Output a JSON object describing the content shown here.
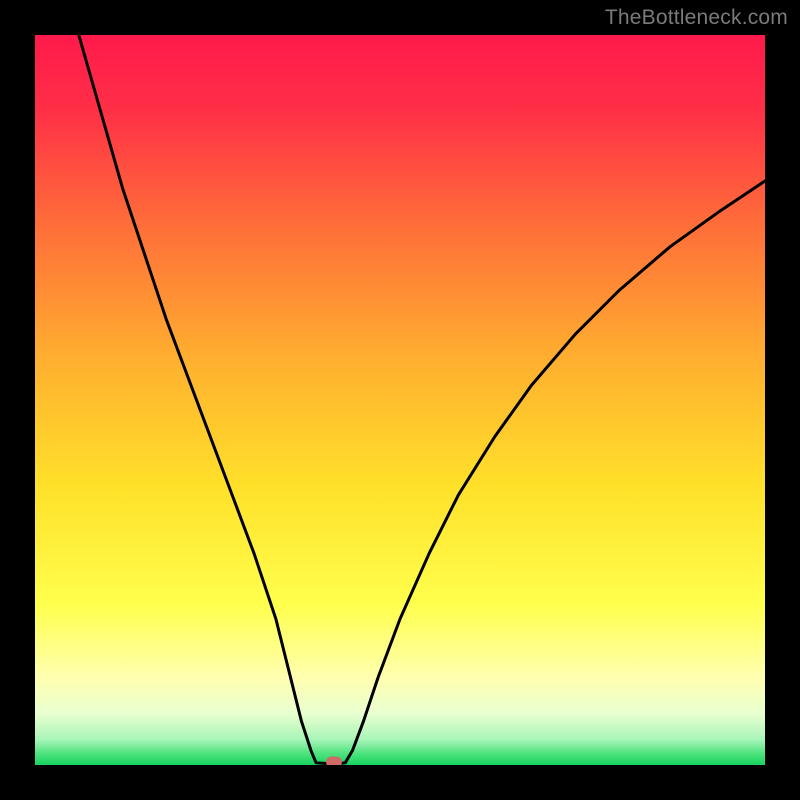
{
  "watermark": {
    "text": "TheBottleneck.com"
  },
  "chart_data": {
    "type": "line",
    "title": "",
    "xlabel": "",
    "ylabel": "",
    "xlim": [
      0,
      100
    ],
    "ylim": [
      0,
      100
    ],
    "grid": false,
    "legend": false,
    "gradient_stops": [
      {
        "offset": 0.0,
        "color": "#ff1a4b"
      },
      {
        "offset": 0.1,
        "color": "#ff2e47"
      },
      {
        "offset": 0.25,
        "color": "#ff6a3a"
      },
      {
        "offset": 0.45,
        "color": "#ffb12f"
      },
      {
        "offset": 0.62,
        "color": "#ffe12a"
      },
      {
        "offset": 0.78,
        "color": "#ffff4d"
      },
      {
        "offset": 0.88,
        "color": "#ffffb0"
      },
      {
        "offset": 0.93,
        "color": "#e9ffd0"
      },
      {
        "offset": 0.965,
        "color": "#a8f5b8"
      },
      {
        "offset": 0.985,
        "color": "#4be27c"
      },
      {
        "offset": 1.0,
        "color": "#17d25e"
      }
    ],
    "series": [
      {
        "name": "bottleneck-curve-left",
        "x": [
          6,
          8,
          10,
          12,
          15,
          18,
          21,
          24,
          27,
          30,
          33,
          35,
          36.5,
          37.8,
          38.5
        ],
        "y": [
          100,
          93,
          86,
          79,
          70,
          61,
          53,
          45,
          37,
          29,
          20,
          12,
          6,
          2,
          0.3
        ]
      },
      {
        "name": "bottleneck-curve-flat",
        "x": [
          38.5,
          40.0,
          41.5,
          42.5
        ],
        "y": [
          0.3,
          0.2,
          0.2,
          0.3
        ]
      },
      {
        "name": "bottleneck-curve-right",
        "x": [
          42.5,
          43.5,
          45,
          47,
          50,
          54,
          58,
          63,
          68,
          74,
          80,
          87,
          94,
          100
        ],
        "y": [
          0.3,
          2,
          6,
          12,
          20,
          29,
          37,
          45,
          52,
          59,
          65,
          71,
          76,
          80
        ]
      }
    ],
    "marker": {
      "x": 41.0,
      "y": 0.4,
      "color": "#cf6a67"
    }
  }
}
